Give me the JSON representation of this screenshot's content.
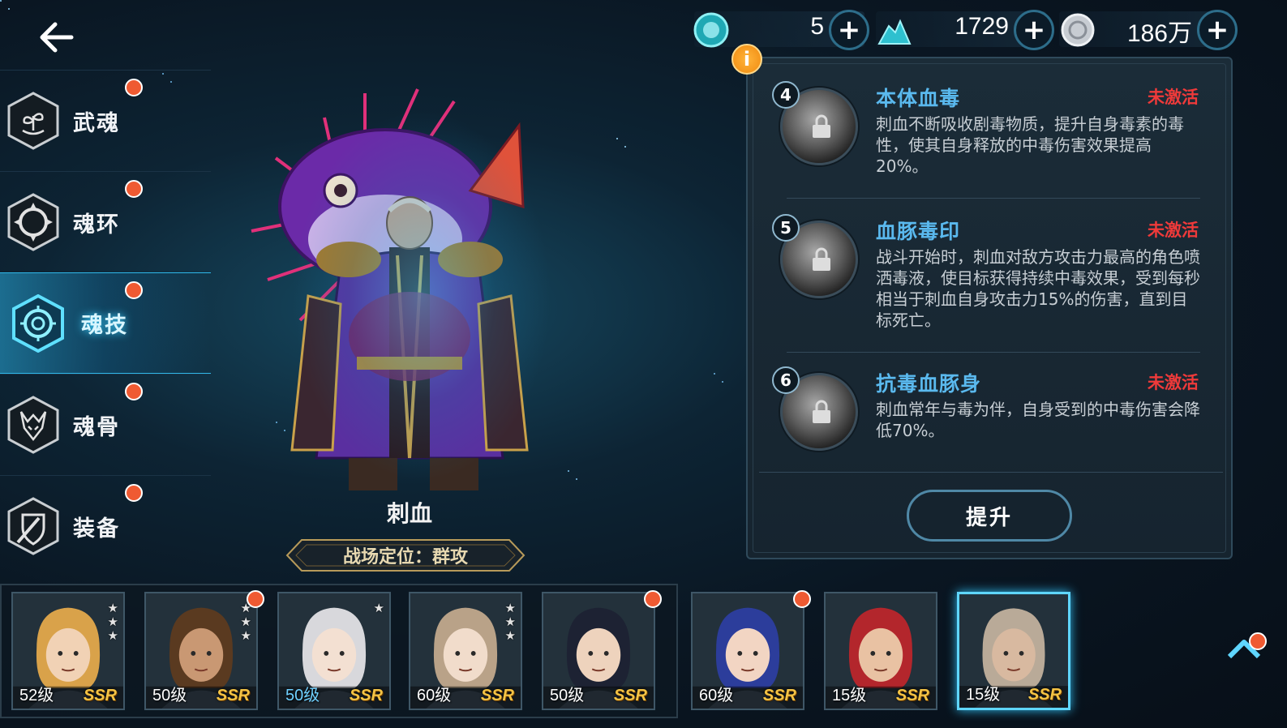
{
  "nav": {
    "items": [
      {
        "label": "武魂",
        "icon": "martial-soul-icon",
        "badge": true,
        "active": false
      },
      {
        "label": "魂环",
        "icon": "soul-ring-icon",
        "badge": true,
        "active": false
      },
      {
        "label": "魂技",
        "icon": "soul-skill-icon",
        "badge": true,
        "active": true
      },
      {
        "label": "魂骨",
        "icon": "soul-bone-icon",
        "badge": true,
        "active": false
      },
      {
        "label": "装备",
        "icon": "equipment-icon",
        "badge": true,
        "active": false
      }
    ]
  },
  "currency": {
    "gems": "5",
    "crystals": "1729",
    "coins": "186万"
  },
  "character": {
    "name": "刺血",
    "role": "战场定位：群攻"
  },
  "skills": [
    {
      "level": "4",
      "title": "本体血毒",
      "status": "未激活",
      "desc": "刺血不断吸收剧毒物质，提升自身毒素的毒性，使其自身释放的中毒伤害效果提高20%。"
    },
    {
      "level": "5",
      "title": "血豚毒印",
      "status": "未激活",
      "desc": "战斗开始时，刺血对敌方攻击力最高的角色喷洒毒液，使目标获得持续中毒效果，受到每秒相当于刺血自身攻击力15%的伤害，直到目标死亡。"
    },
    {
      "level": "6",
      "title": "抗毒血豚身",
      "status": "未激活",
      "desc": "刺血常年与毒为伴，自身受到的中毒伤害会降低70%。"
    }
  ],
  "upgrade_label": "提升",
  "roster": [
    {
      "level": "52级",
      "rarity": "SSR",
      "stars": 3,
      "badge": false,
      "highlight": false,
      "hair": "#d9a24a",
      "skin": "#f1d2b5"
    },
    {
      "level": "50级",
      "rarity": "SSR",
      "stars": 3,
      "badge": true,
      "highlight": false,
      "hair": "#5a3a20",
      "skin": "#c99873"
    },
    {
      "level": "50级",
      "rarity": "SSR",
      "stars": 1,
      "badge": false,
      "highlight": true,
      "hair": "#d8d8dc",
      "skin": "#f3e0d2"
    },
    {
      "level": "60级",
      "rarity": "SSR",
      "stars": 3,
      "badge": false,
      "highlight": false,
      "hair": "#b9a288",
      "skin": "#f1dccb"
    },
    {
      "level": "50级",
      "rarity": "SSR",
      "stars": 0,
      "badge": true,
      "highlight": false,
      "hair": "#1d2233",
      "skin": "#eed3bd"
    },
    {
      "level": "60级",
      "rarity": "SSR",
      "stars": 0,
      "badge": true,
      "highlight": false,
      "hair": "#2c3d9b",
      "skin": "#f2d5c3"
    },
    {
      "level": "15级",
      "rarity": "SSR",
      "stars": 0,
      "badge": false,
      "highlight": false,
      "hair": "#b3262c",
      "skin": "#e9c2a3"
    },
    {
      "level": "15级",
      "rarity": "SSR",
      "stars": 0,
      "badge": false,
      "highlight": false,
      "selected": true,
      "hair": "#b9aa98",
      "skin": "#d8b9a0"
    }
  ],
  "colors": {
    "accent": "#2fb8ea",
    "badge": "#ef5a32",
    "skill_title": "#5ab9ee",
    "inactive": "#ef3a3a",
    "ssr": "#f4c445"
  }
}
